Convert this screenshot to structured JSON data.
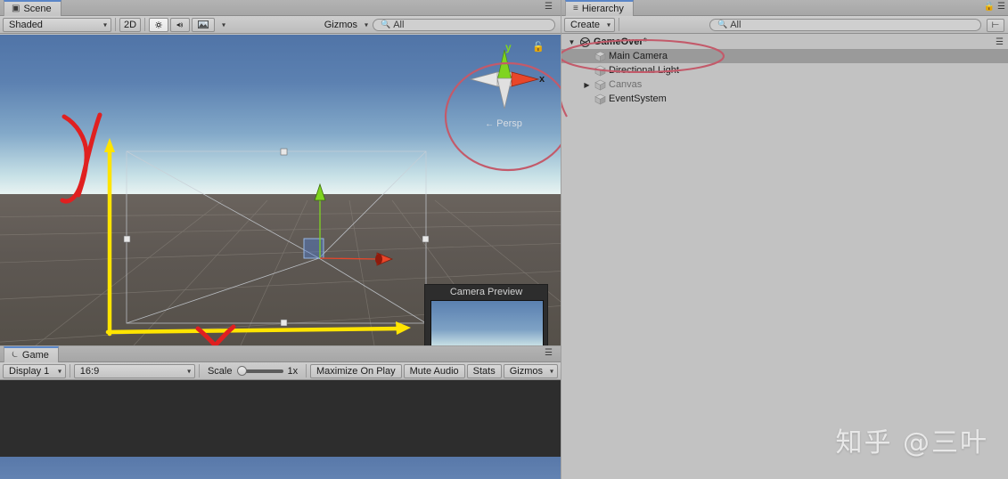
{
  "scene": {
    "tab_label": "Scene",
    "tab_icon": "scene-icon",
    "shading_mode": "Shaded",
    "mode_2d": "2D",
    "light_icon": "sun-icon",
    "audio_icon": "speaker-icon",
    "fx_icon": "image-icon",
    "gizmos_label": "Gizmos",
    "search_placeholder": "All",
    "search_value": "",
    "gizmo": {
      "axis_y_label": "y",
      "axis_x_label": "x",
      "projection_label": "Persp",
      "lock_icon": "lock-icon",
      "color_y": "#7fd420",
      "color_x": "#e8462a",
      "color_z": "#d8d8d8"
    },
    "camera_preview_title": "Camera Preview",
    "annotations": {
      "axis_y_handwritten": "y",
      "axis_x_handwritten": "x",
      "annotation_color": "#e02020",
      "ellipse_color": "#c35a6a"
    },
    "sky_top_color": "#5074a7",
    "ground_color": "#5e5853"
  },
  "game": {
    "tab_label": "Game",
    "tab_icon": "game-icon",
    "display": "Display 1",
    "aspect": "16:9",
    "scale_label": "Scale",
    "scale_value": "1x",
    "maximize_on_play": "Maximize On Play",
    "mute_audio": "Mute Audio",
    "stats": "Stats",
    "gizmos": "Gizmos"
  },
  "hierarchy": {
    "tab_label": "Hierarchy",
    "tab_icon": "hierarchy-icon",
    "create_label": "Create",
    "search_placeholder": "All",
    "search_value": "",
    "lock_icon": "lock-icon",
    "menu_icon": "menu-icon",
    "sort_icon": "sort-icon",
    "items": [
      {
        "label": "GameOver*",
        "depth": 0,
        "expandable": true,
        "expanded": true,
        "selected": false,
        "dim": false,
        "icon": "scene-icon"
      },
      {
        "label": "Main Camera",
        "depth": 1,
        "expandable": false,
        "expanded": false,
        "selected": true,
        "dim": false,
        "icon": "gameobject-icon"
      },
      {
        "label": "Directional Light",
        "depth": 1,
        "expandable": false,
        "expanded": false,
        "selected": false,
        "dim": false,
        "icon": "gameobject-icon"
      },
      {
        "label": "Canvas",
        "depth": 1,
        "expandable": true,
        "expanded": false,
        "selected": false,
        "dim": true,
        "icon": "gameobject-icon"
      },
      {
        "label": "EventSystem",
        "depth": 1,
        "expandable": false,
        "expanded": false,
        "selected": false,
        "dim": false,
        "icon": "gameobject-icon"
      }
    ]
  },
  "watermark": {
    "text": "知乎 @三叶"
  }
}
